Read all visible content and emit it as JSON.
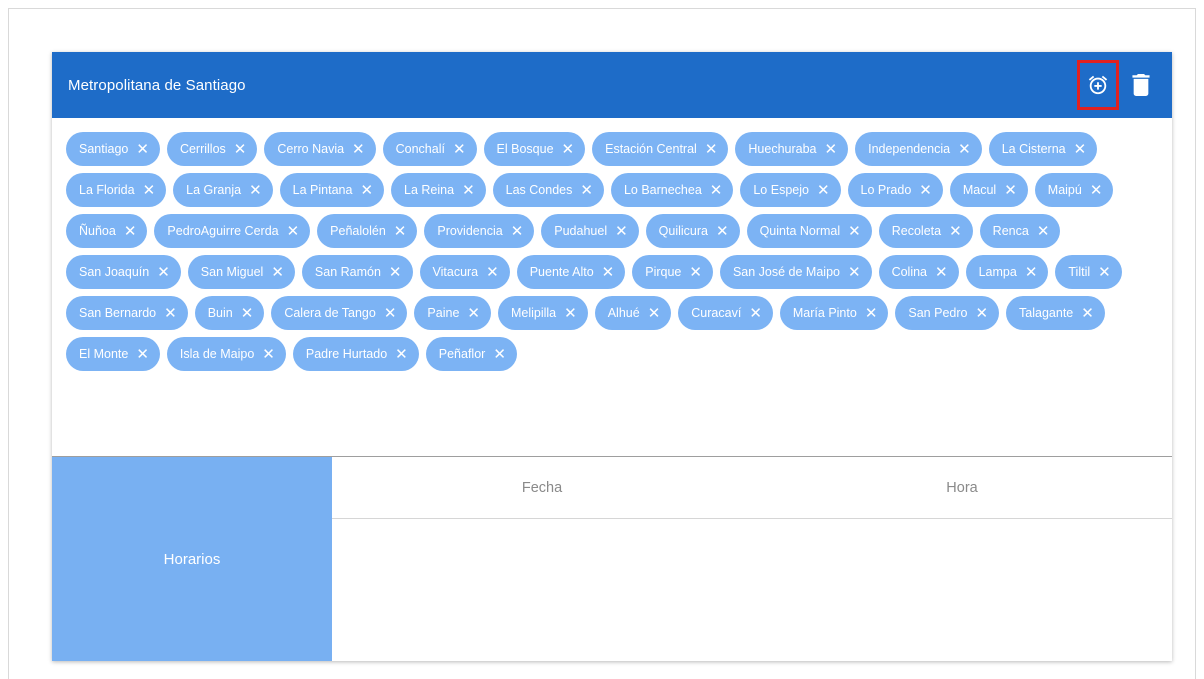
{
  "region": {
    "title": "Metropolitana de Santiago",
    "actions": [
      {
        "icon": "alarm-add-icon",
        "color": "#ffffff",
        "highlighted": true
      },
      {
        "icon": "trash-icon",
        "color": "#ffffff"
      }
    ]
  },
  "colors": {
    "header": "#1e6cc8",
    "chip": "#7cb3f4",
    "schedule_label": "#78b0f2",
    "highlight": "#e0211f"
  },
  "communes": [
    "Santiago",
    "Cerrillos",
    "Cerro Navia",
    "Conchalí",
    "El Bosque",
    "Estación Central",
    "Huechuraba",
    "Independencia",
    "La Cisterna",
    "La Florida",
    "La Granja",
    "La Pintana",
    "La Reina",
    "Las Condes",
    "Lo Barnechea",
    "Lo Espejo",
    "Lo Prado",
    "Macul",
    "Maipú",
    "Ñuñoa",
    "PedroAguirre Cerda",
    "Peñalolén",
    "Providencia",
    "Pudahuel",
    "Quilicura",
    "Quinta Normal",
    "Recoleta",
    "Renca",
    "San Joaquín",
    "San Miguel",
    "San Ramón",
    "Vitacura",
    "Puente Alto",
    "Pirque",
    "San José de Maipo",
    "Colina",
    "Lampa",
    "Tiltil",
    "San Bernardo",
    "Buin",
    "Calera de Tango",
    "Paine",
    "Melipilla",
    "Alhué",
    "Curacaví",
    "María Pinto",
    "San Pedro",
    "Talagante",
    "El Monte",
    "Isla de Maipo",
    "Padre Hurtado",
    "Peñaflor"
  ],
  "chip_remove_symbol": "✕",
  "schedule": {
    "label": "Horarios",
    "columns": [
      "Fecha",
      "Hora"
    ],
    "rows": []
  }
}
